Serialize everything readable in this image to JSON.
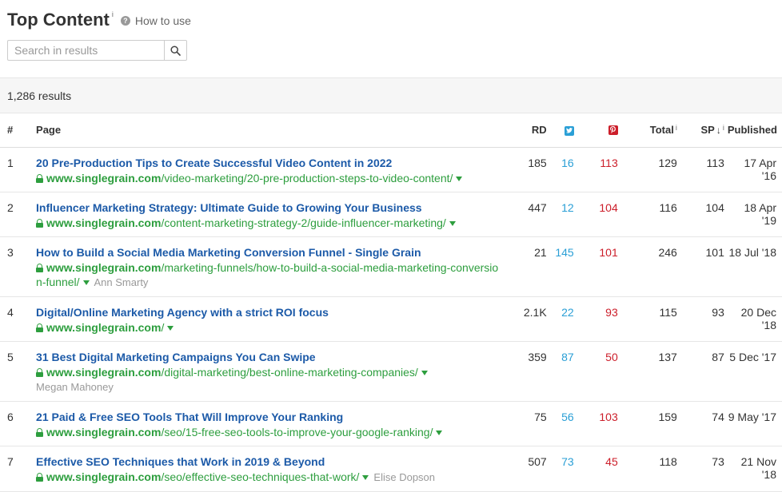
{
  "header": {
    "title": "Top Content",
    "title_info": "i",
    "how_to_use": "How to use"
  },
  "search": {
    "placeholder": "Search in results",
    "value": ""
  },
  "results_count": "1,286 results",
  "columns": {
    "num": "#",
    "page": "Page",
    "rd": "RD",
    "total": "Total",
    "total_info": "i",
    "sp": "SP",
    "sp_arrow": "↓",
    "sp_info": "i",
    "published": "Published"
  },
  "colors": {
    "title_link": "#1c5aa8",
    "url_green": "#2d9e3e",
    "twitter": "#2a9fd6",
    "pinterest": "#cc1e2a"
  },
  "rows": [
    {
      "num": "1",
      "title": "20 Pre-Production Tips to Create Successful Video Content in 2022",
      "domain": "www.singlegrain.com",
      "path": "/video-marketing/20-pre-production-steps-to-video-content/",
      "author": "",
      "rd": "185",
      "twitter": "16",
      "pinterest": "113",
      "total": "129",
      "sp": "113",
      "published": "17 Apr '16"
    },
    {
      "num": "2",
      "title": "Influencer Marketing Strategy: Ultimate Guide to Growing Your Business",
      "domain": "www.singlegrain.com",
      "path": "/content-marketing-strategy-2/guide-influencer-marketing/",
      "author": "",
      "rd": "447",
      "twitter": "12",
      "pinterest": "104",
      "total": "116",
      "sp": "104",
      "published": "18 Apr '19"
    },
    {
      "num": "3",
      "title": "How to Build a Social Media Marketing Conversion Funnel - Single Grain",
      "domain": "www.singlegrain.com",
      "path": "/marketing-funnels/how-to-build-a-social-media-marketing-conversion-funnel/",
      "author": "Ann Smarty",
      "rd": "21",
      "twitter": "145",
      "pinterest": "101",
      "total": "246",
      "sp": "101",
      "published": "18 Jul '18"
    },
    {
      "num": "4",
      "title": "Digital/Online Marketing Agency with a strict ROI focus",
      "domain": "www.singlegrain.com",
      "path": "/",
      "author": "",
      "rd": "2.1K",
      "twitter": "22",
      "pinterest": "93",
      "total": "115",
      "sp": "93",
      "published": "20 Dec '18"
    },
    {
      "num": "5",
      "title": "31 Best Digital Marketing Campaigns You Can Swipe",
      "domain": "www.singlegrain.com",
      "path": "/digital-marketing/best-online-marketing-companies/",
      "author": "Megan Mahoney",
      "rd": "359",
      "twitter": "87",
      "pinterest": "50",
      "total": "137",
      "sp": "87",
      "published": "5 Dec '17"
    },
    {
      "num": "6",
      "title": "21 Paid & Free SEO Tools That Will Improve Your Ranking",
      "domain": "www.singlegrain.com",
      "path": "/seo/15-free-seo-tools-to-improve-your-google-ranking/",
      "author": "",
      "rd": "75",
      "twitter": "56",
      "pinterest": "103",
      "total": "159",
      "sp": "74",
      "published": "9 May '17"
    },
    {
      "num": "7",
      "title": "Effective SEO Techniques that Work in 2019 & Beyond",
      "domain": "www.singlegrain.com",
      "path": "/seo/effective-seo-techniques-that-work/",
      "author": "Elise Dopson",
      "rd": "507",
      "twitter": "73",
      "pinterest": "45",
      "total": "118",
      "sp": "73",
      "published": "21 Nov '18"
    }
  ]
}
